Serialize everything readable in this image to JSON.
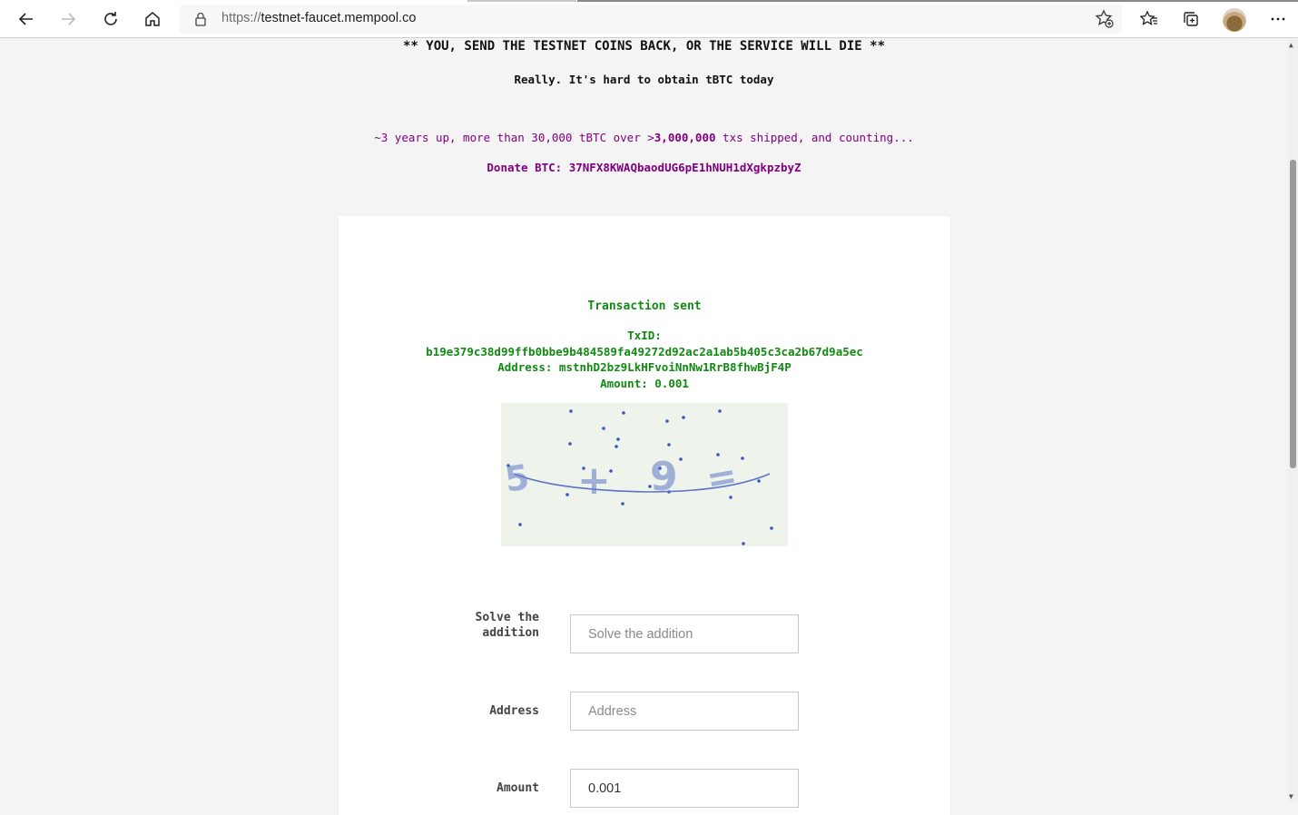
{
  "browser": {
    "url_protocol": "https://",
    "url_host": "testnet-faucet.mempool.co"
  },
  "page": {
    "warning": "** YOU, SEND THE TESTNET COINS BACK, OR THE SERVICE WILL DIE **",
    "subtitle": "Really. It's hard to obtain tBTC today",
    "stats_prefix": "~3 years up, more than 30,000 tBTC over >",
    "stats_bold": "3,000,000",
    "stats_suffix": " txs shipped, and counting...",
    "donate": "Donate BTC: 37NFX8KWAQbaodUG6pE1hNUH1dXgkpzbyZ"
  },
  "result": {
    "title": "Transaction sent",
    "txid_label": "TxID:",
    "txid": "b19e379c38d99ffb0bbe9b484589fa49272d92ac2a1ab5b405c3ca2b67d9a5ec",
    "address_line": "Address: mstnhD2bz9LkHFvoiNnNw1RrB8fhwBjF4P",
    "amount_line": "Amount: 0.001"
  },
  "captcha": {
    "glyphs": [
      "5",
      "+",
      "9",
      "="
    ],
    "color": "#3a57c4"
  },
  "form": {
    "solve_label": "Solve the addition",
    "solve_placeholder": "Solve the addition",
    "address_label": "Address",
    "address_placeholder": "Address",
    "amount_label": "Amount",
    "amount_value": "0.001"
  }
}
